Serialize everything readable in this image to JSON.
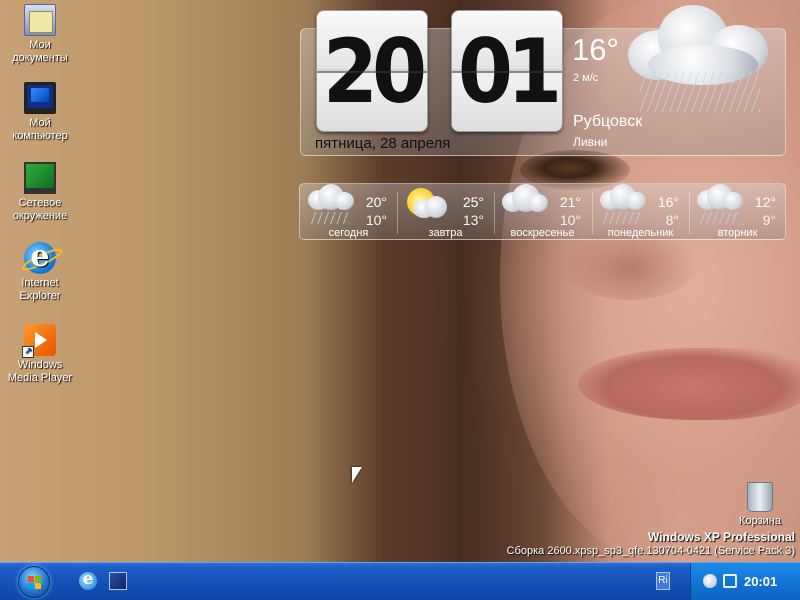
{
  "desktop": {
    "icons": [
      {
        "label": "Мои документы"
      },
      {
        "label": "Мой компьютер"
      },
      {
        "label": "Сетевое окружение"
      },
      {
        "label": "Internet Explorer"
      },
      {
        "label": "Windows Media Player"
      }
    ],
    "recycle_bin": {
      "label": "Корзина"
    },
    "version": {
      "name": "Windows XP Professional",
      "build": "Сборка 2600.xpsp_sp3_qfe.130704-0421 (Service Pack 3)"
    }
  },
  "clock_widget": {
    "hours": "20",
    "minutes": "01",
    "date": "пятница, 28 апреля",
    "temperature": "16°",
    "wind": "2 м/с",
    "city": "Рубцовск",
    "condition": "Ливни"
  },
  "forecast": [
    {
      "day": "сегодня",
      "high": "20°",
      "low": "10°",
      "icon": "rain-cloud-icon"
    },
    {
      "day": "завтра",
      "high": "25°",
      "low": "13°",
      "icon": "partly-sunny-icon"
    },
    {
      "day": "воскресенье",
      "high": "21°",
      "low": "10°",
      "icon": "cloud-icon"
    },
    {
      "day": "понедельник",
      "high": "16°",
      "low": "8°",
      "icon": "rain-cloud-icon"
    },
    {
      "day": "вторник",
      "high": "12°",
      "low": "9°",
      "icon": "rain-cloud-icon"
    }
  ],
  "taskbar": {
    "tray_lang": "Ri",
    "time": "20:01"
  },
  "colors": {
    "taskbar_blue": "#1550b6",
    "tray_blue": "#1274d6"
  }
}
